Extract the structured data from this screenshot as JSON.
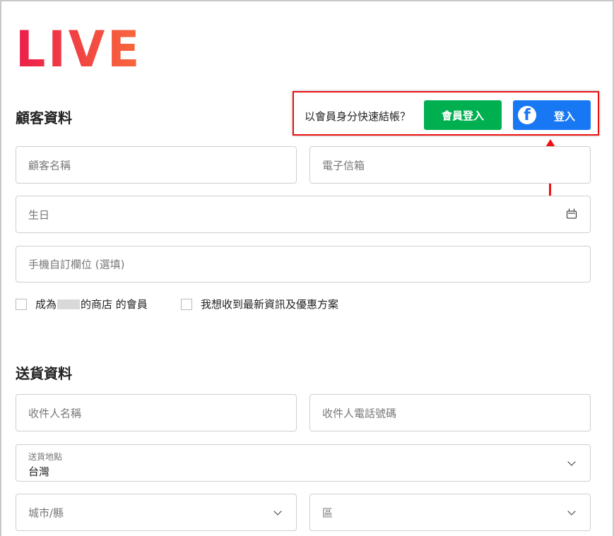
{
  "logo": "LIVE",
  "customer": {
    "title": "顧客資料",
    "name_placeholder": "顧客名稱",
    "email_placeholder": "電子信箱",
    "birthday_placeholder": "生日",
    "phone_placeholder": "手機自訂欄位 (選填)",
    "member_checkbox_prefix": "成為",
    "member_checkbox_suffix": "的商店 的會員",
    "newsletter_checkbox": "我想收到最新資訊及優惠方案"
  },
  "login": {
    "prompt": "以會員身分快速結帳？",
    "member_button": "會員登入",
    "facebook_button": "登入",
    "facebook_icon": "facebook-icon"
  },
  "shipping": {
    "title": "送貨資料",
    "recipient_name_placeholder": "收件人名稱",
    "recipient_phone_placeholder": "收件人電話號碼",
    "location_label": "送貨地點",
    "location_value": "台灣",
    "city_placeholder": "城市/縣",
    "district_placeholder": "區"
  },
  "colors": {
    "member_button": "#00b050",
    "facebook_button": "#1877f2",
    "highlight": "#ee1111"
  }
}
